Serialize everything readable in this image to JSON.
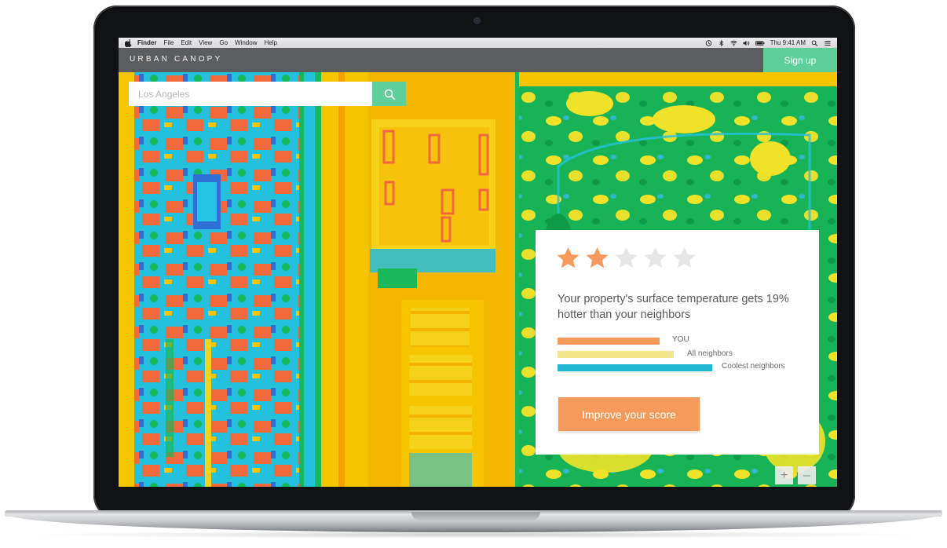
{
  "menubar": {
    "items": [
      "Finder",
      "File",
      "Edit",
      "View",
      "Go",
      "Window",
      "Help"
    ],
    "clock": "Thu 9:41 AM"
  },
  "app": {
    "brand": "URBAN CANOPY",
    "signup_label": "Sign up",
    "search": {
      "placeholder": "Los Angeles",
      "value": ""
    }
  },
  "scorecard": {
    "rating": 2,
    "rating_max": 5,
    "headline": "Your property's surface temperature gets 19% hotter than your neighbors",
    "bars": [
      {
        "label": "YOU",
        "color": "#f59a5a",
        "fraction": 0.66
      },
      {
        "label": "All neighbors",
        "color": "#f3e58a",
        "fraction": 0.75
      },
      {
        "label": "Coolest neighbors",
        "color": "#22b7d3",
        "fraction": 1.0
      }
    ],
    "cta_label": "Improve your score"
  },
  "zoom": {
    "in_label": "+",
    "out_label": "–"
  },
  "colors": {
    "accent": "#5fcf9a",
    "star_on": "#f59a5a",
    "star_off": "#e6e6e6",
    "heat_hot": "#f26a3b",
    "heat_warm": "#f7c500",
    "heat_cool": "#2ec4e8",
    "heat_veg": "#19b85a"
  }
}
